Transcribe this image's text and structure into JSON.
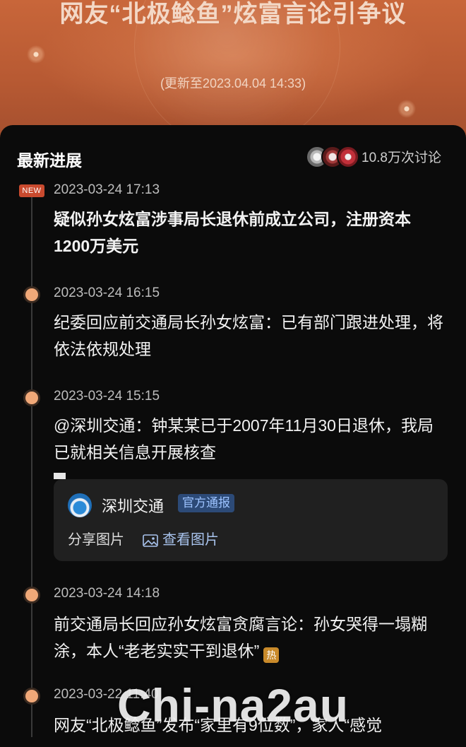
{
  "header": {
    "title": "网友“北极鲶鱼”炫富言论引争议",
    "updated": "(更新至2023.04.04 14:33)"
  },
  "section": {
    "title": "最新进展",
    "discussion_count": "10.8万次讨论"
  },
  "timeline": [
    {
      "badge": "NEW",
      "time": "2023-03-24 17:13",
      "text": "疑似孙女炫富涉事局长退休前成立公司，注册资本1200万美元"
    },
    {
      "time": "2023-03-24 16:15",
      "text": "纪委回应前交通局长孙女炫富：已有部门跟进处理，将依法依规处理"
    },
    {
      "time": "2023-03-24 15:15",
      "text": "@深圳交通：钟某某已于2007年11月30日退休，我局已就相关信息开展核查",
      "share": {
        "org_name": "深圳交通",
        "org_tag": "官方通报",
        "share_label": "分享图片",
        "view_label": "查看图片"
      }
    },
    {
      "time": "2023-03-24 14:18",
      "text": "前交通局长回应孙女炫富贪腐言论：孙女哭得一塌糊涂，本人“老老实实干到退休”",
      "hot_label": "热"
    },
    {
      "time": "2023-03-22 11:40",
      "text": "网友“北极鲶鱼”发布“家里有9位数”，家人“感觉"
    }
  ],
  "watermark": "Chi-na2au",
  "colors": {
    "hero": "#b85a33",
    "timeline_dot": "#f0a878",
    "new_badge": "#c94a2e",
    "tag_bg": "#2c4a77",
    "link": "#a9c4ee"
  }
}
